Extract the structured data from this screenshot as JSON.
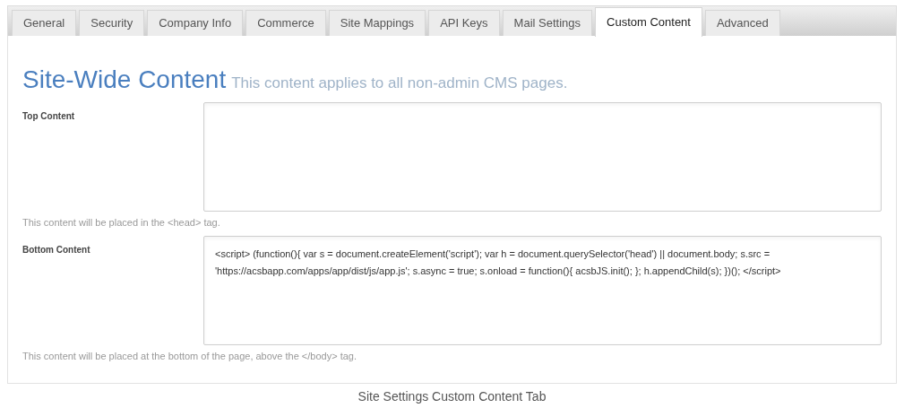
{
  "tabs": [
    {
      "label": "General",
      "selected": false
    },
    {
      "label": "Security",
      "selected": false
    },
    {
      "label": "Company Info",
      "selected": false
    },
    {
      "label": "Commerce",
      "selected": false
    },
    {
      "label": "Site Mappings",
      "selected": false
    },
    {
      "label": "API Keys",
      "selected": false
    },
    {
      "label": "Mail Settings",
      "selected": false
    },
    {
      "label": "Custom Content",
      "selected": true
    },
    {
      "label": "Advanced",
      "selected": false
    }
  ],
  "heading": {
    "title": "Site-Wide Content",
    "subtitle": "This content applies to all non-admin CMS pages."
  },
  "fields": [
    {
      "label": "Top Content",
      "hint": "This content will be placed in the <head> tag."
    },
    {
      "label": "Bottom Content",
      "value": "<script> (function(){ var s = document.createElement('script'); var h = document.querySelector('head') || document.body; s.src = 'https://acsbapp.com/apps/app/dist/js/app.js'; s.async = true; s.onload = function(){ acsbJS.init(); }; h.appendChild(s); })(); </script>",
      "hint": "This content will be placed at the bottom of the page, above the </body> tag."
    }
  ],
  "caption": "Site Settings Custom Content Tab"
}
